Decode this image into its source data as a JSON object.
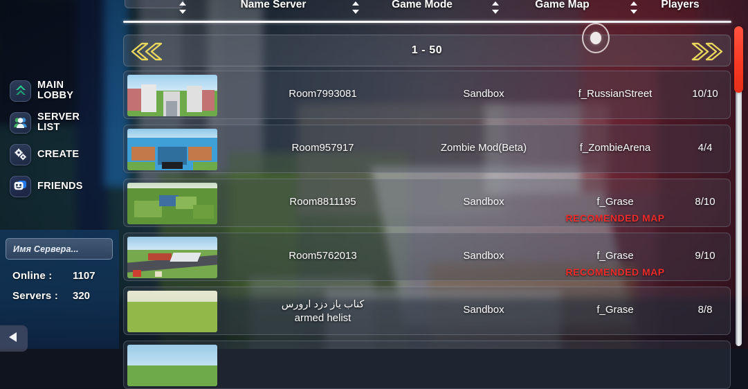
{
  "table": {
    "columns": [
      {
        "label": "Name Server",
        "sortable": true
      },
      {
        "label": "Game Mode",
        "sortable": true
      },
      {
        "label": "Game Map",
        "sortable": true
      },
      {
        "label": "Players",
        "sortable": false
      }
    ],
    "pagination": {
      "range_label": "1 - 50",
      "prev_icon": "double-chevron-left-icon",
      "next_icon": "double-chevron-right-icon"
    },
    "rows": [
      {
        "name": "Room7993081",
        "name_secondary": "",
        "mode": "Sandbox",
        "map": "f_RussianStreet",
        "players": "10/10",
        "badge": "",
        "thumb": "city-street-thumbnail"
      },
      {
        "name": "Room957917",
        "name_secondary": "",
        "mode": "Zombie Mod(Beta)",
        "map": "f_ZombieArena",
        "players": "4/4",
        "badge": "",
        "thumb": "island-arena-thumbnail"
      },
      {
        "name": "Room8811195",
        "name_secondary": "",
        "mode": "Sandbox",
        "map": "f_Grase",
        "players": "8/10",
        "badge": "RECOMENDED MAP",
        "thumb": "forest-thumbnail"
      },
      {
        "name": "Room5762013",
        "name_secondary": "",
        "mode": "Sandbox",
        "map": "f_Grase",
        "players": "9/10",
        "badge": "RECOMENDED MAP",
        "thumb": "airport-runway-thumbnail"
      },
      {
        "name": "كناب ياز دزد ارورس",
        "name_secondary": "armed helist",
        "mode": "Sandbox",
        "map": "f_Grase",
        "players": "8/8",
        "badge": "",
        "thumb": "green-field-thumbnail"
      }
    ]
  },
  "sidebar": {
    "items": [
      {
        "label": "MAIN LOBBY",
        "line1": "MAIN",
        "line2": "LOBBY",
        "icon": "double-chevron-up-icon"
      },
      {
        "label": "SERVER LIST",
        "line1": "SERVER",
        "line2": "LIST",
        "icon": "users-group-icon"
      },
      {
        "label": "CREATE",
        "line1": "CREATE",
        "line2": "",
        "icon": "gears-icon"
      },
      {
        "label": "FRIENDS",
        "line1": "FRIENDS",
        "line2": "",
        "icon": "chat-face-icon"
      }
    ],
    "search": {
      "placeholder": "Имя Сервера...",
      "value": ""
    },
    "stats": [
      {
        "label": "Online :",
        "value": "1107"
      },
      {
        "label": "Servers :",
        "value": "320"
      }
    ],
    "back_button": {
      "icon": "back-arrow-icon",
      "label": ""
    }
  },
  "colors": {
    "accent_yellow": "#e8d75c",
    "badge_red": "#ef2b2b",
    "scrollbar_red": "#f83a24",
    "panel_blue": "#13375c",
    "text_white": "#ffffff"
  }
}
